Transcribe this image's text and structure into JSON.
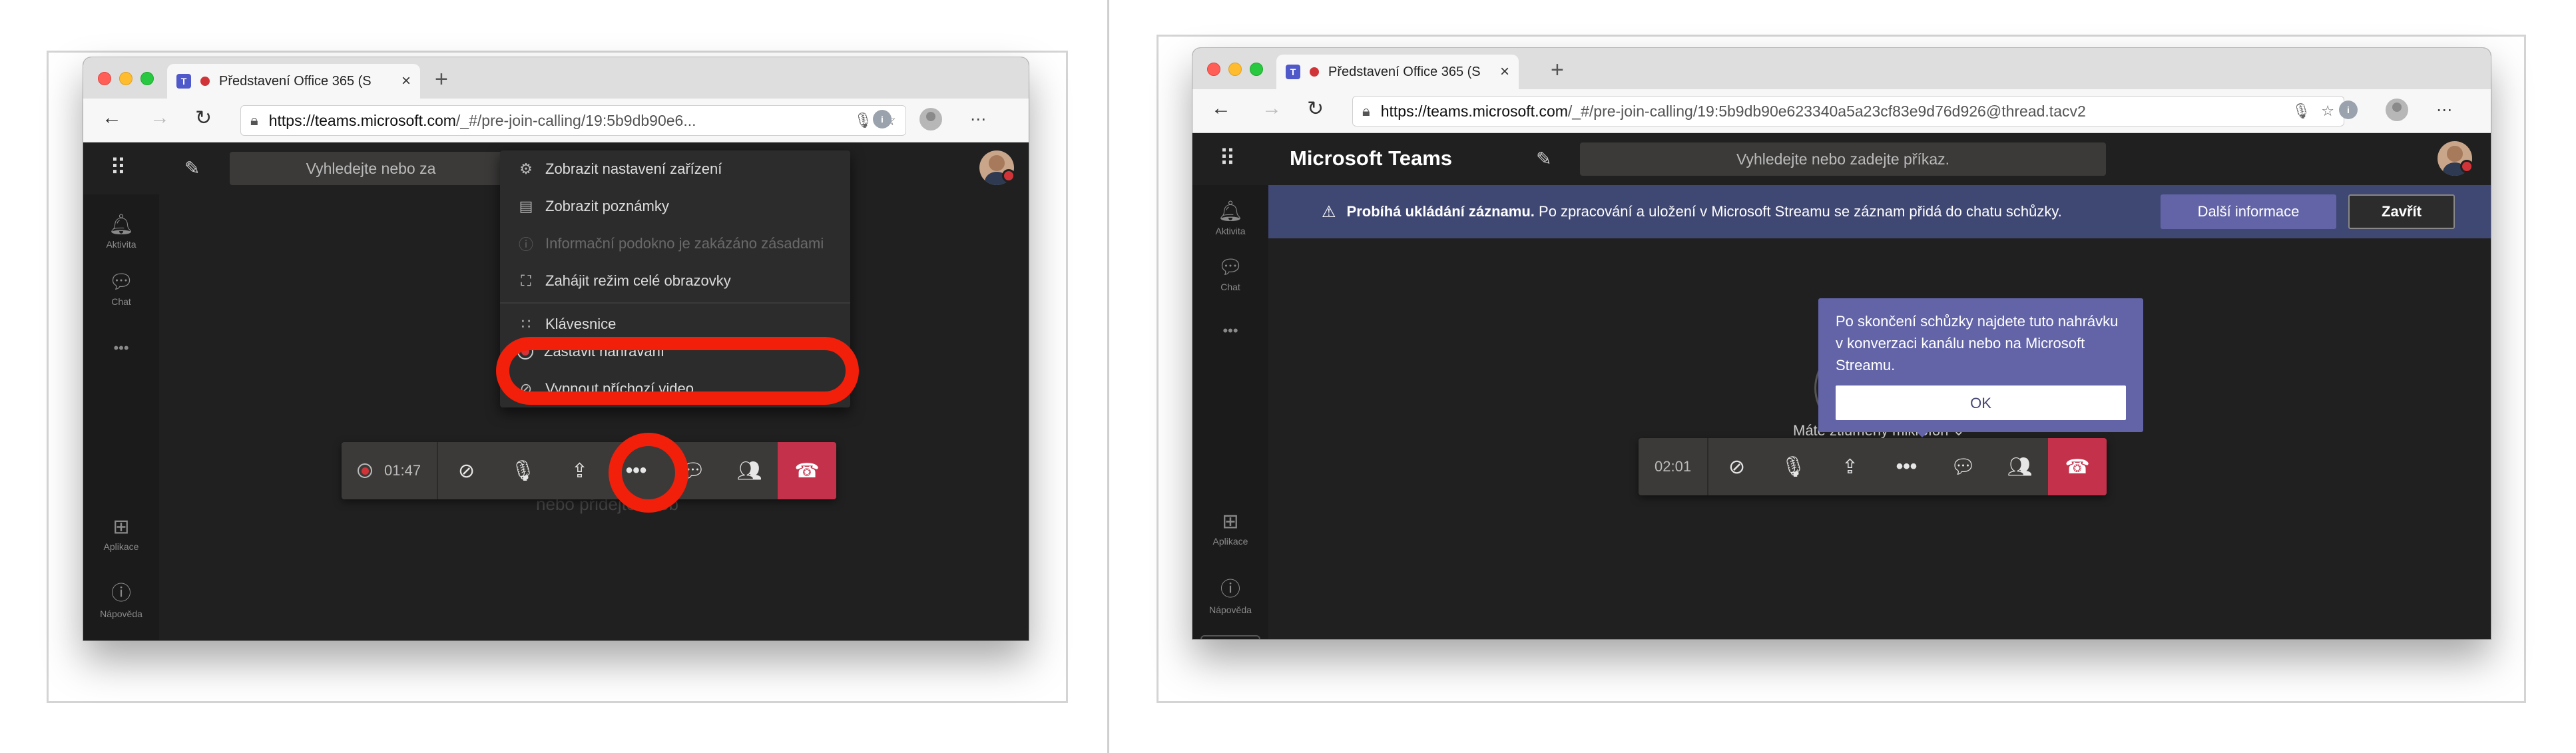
{
  "left": {
    "tab_title": "Představení Office 365 (S",
    "url_host": "https://teams.microsoft.com",
    "url_rest": "/_#/pre-join-calling/19:5b9db90e6...",
    "search_placeholder": "Vyhledejte nebo za",
    "rail": {
      "activity": "Aktivita",
      "chat": "Chat",
      "more": "•••",
      "apps": "Aplikace",
      "help": "Nápověda"
    },
    "menu": [
      {
        "icon": "gear-icon",
        "glyph": "⚙",
        "label": "Zobrazit nastavení zařízení",
        "disabled": false
      },
      {
        "icon": "notes-icon",
        "glyph": "▤",
        "label": "Zobrazit poznámky",
        "disabled": false
      },
      {
        "icon": "info-icon",
        "glyph": "ⓘ",
        "label": "Informační podokno je zakázáno zásadami",
        "disabled": true
      },
      {
        "icon": "fullscreen-icon",
        "glyph": "⛶",
        "label": "Zahájit režim celé obrazovky",
        "disabled": false
      },
      {
        "icon": "keypad-icon",
        "glyph": "∷",
        "label": "Klávesnice",
        "disabled": false
      },
      {
        "icon": "record-icon",
        "glyph": "",
        "label": "Zastavit nahrávání",
        "disabled": false
      },
      {
        "icon": "video-off-icon",
        "glyph": "⚠",
        "label": "Vypnout příchozí video",
        "disabled": false
      }
    ],
    "call_timer": "01:47",
    "ghost_text": "nebo přidejte osob"
  },
  "right": {
    "tab_title": "Představení Office 365 (S",
    "url_host": "https://teams.microsoft.com",
    "url_rest": "/_#/pre-join-calling/19:5b9db90e623340a5a23cf83e9d76d926@thread.tacv2",
    "app_title": "Microsoft Teams",
    "search_placeholder": "Vyhledejte nebo zadejte příkaz.",
    "rail": {
      "activity": "Aktivita",
      "chat": "Chat",
      "more": "•••",
      "apps": "Aplikace",
      "help": "Nápověda"
    },
    "banner": {
      "bold": "Probíhá ukládání záznamu.",
      "text": " Po zpracování a uložení v Microsoft Streamu se záznam přidá do chatu schůzky.",
      "more_btn": "Další informace",
      "close_btn": "Zavřít"
    },
    "tooltip": {
      "text": "Po skončení schůzky najdete tuto nahrávku v konverzaci kanálu nebo na Microsoft Streamu.",
      "ok": "OK"
    },
    "mic_notice": "Máte ztlumený mikrofon",
    "call_timer": "02:01"
  },
  "colors": {
    "accent": "#6264a7",
    "hangup": "#c4314b",
    "highlight_ring": "#f21f0a",
    "banner": "#3f4773",
    "recording": "#d13438"
  }
}
